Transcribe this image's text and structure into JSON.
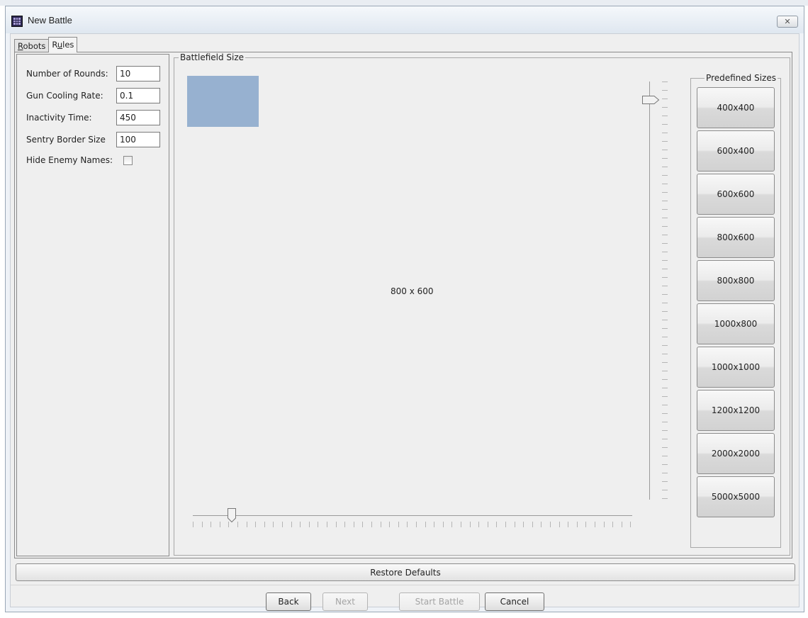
{
  "window": {
    "title": "New Battle",
    "icon": "robocode-app-icon",
    "close_icon": "close-icon"
  },
  "tabs": [
    {
      "label": "Robots",
      "active": false
    },
    {
      "label": "Rules",
      "active": true
    }
  ],
  "rules": {
    "rounds_label": "Number of Rounds:",
    "rounds_value": "10",
    "gun_cooling_label": "Gun Cooling Rate:",
    "gun_cooling_value": "0.1",
    "inactivity_label": "Inactivity Time:",
    "inactivity_value": "450",
    "sentry_label": "Sentry Border Size",
    "sentry_value": "100",
    "hide_names_label": "Hide Enemy Names:",
    "hide_names_checked": false
  },
  "battlefield": {
    "group_title": "Battlefield Size",
    "size_label": "800 x 600",
    "preview_color": "#97b1d0",
    "width_slider_value": 800,
    "height_slider_value": 600
  },
  "predefined": {
    "group_title": "Predefined Sizes",
    "sizes": [
      "400x400",
      "600x400",
      "600x600",
      "800x600",
      "800x800",
      "1000x800",
      "1000x1000",
      "1200x1200",
      "2000x2000",
      "5000x5000"
    ]
  },
  "actions": {
    "restore": "Restore Defaults",
    "back": "Back",
    "next": "Next",
    "start": "Start Battle",
    "cancel": "Cancel",
    "next_enabled": false,
    "start_enabled": false
  }
}
